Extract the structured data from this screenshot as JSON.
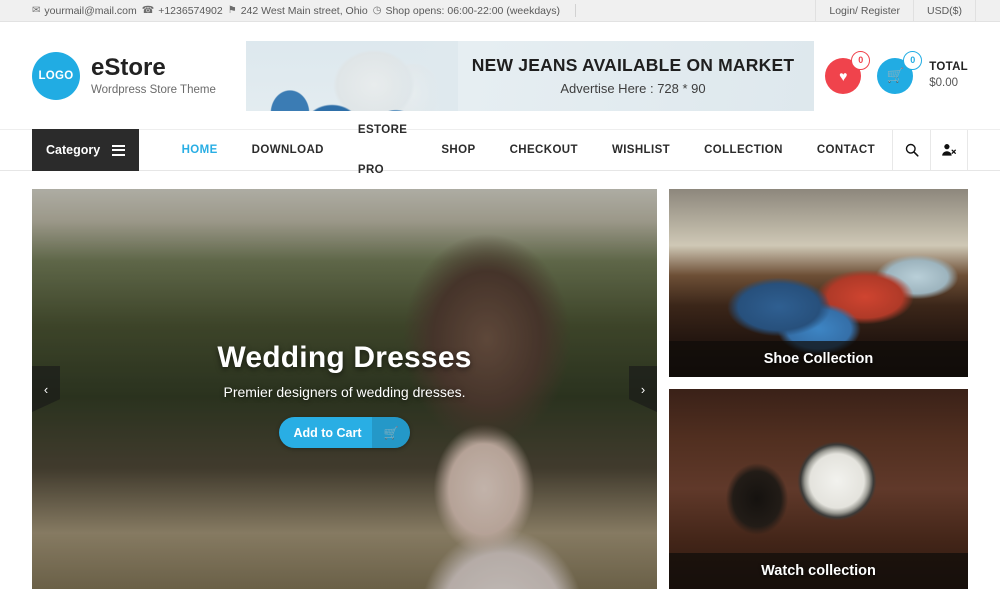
{
  "topbar": {
    "email": "yourmail@mail.com",
    "phone": "+1236574902",
    "address": "242 West Main street, Ohio",
    "hours": "Shop opens: 06:00-22:00 (weekdays)",
    "login": "Login/ Register",
    "currency": "USD($)",
    "icons": {
      "mail": "✉",
      "phone": "☎",
      "pin": "⚑",
      "clock": "◷"
    }
  },
  "header": {
    "logo_text": "LOGO",
    "brand_name": "eStore",
    "brand_tagline": "Wordpress Store Theme",
    "banner": {
      "title": "NEW JEANS AVAILABLE ON MARKET",
      "subtitle": "Advertise Here : 728 * 90"
    },
    "wishlist_count": "0",
    "cart_count": "0",
    "total_label": "TOTAL",
    "total_amount": "$0.00",
    "wishlist_icon": "♥",
    "cart_icon": "🛒"
  },
  "nav": {
    "category_label": "Category",
    "items": [
      {
        "label": "HOME",
        "active": true
      },
      {
        "label": "DOWNLOAD",
        "active": false
      },
      {
        "label": "ESTORE PRO",
        "active": false
      },
      {
        "label": "SHOP",
        "active": false
      },
      {
        "label": "CHECKOUT",
        "active": false
      },
      {
        "label": "WISHLIST",
        "active": false
      },
      {
        "label": "COLLECTION",
        "active": false
      },
      {
        "label": "CONTACT",
        "active": false
      }
    ],
    "search_icon": "🔍",
    "account_icon": "👤"
  },
  "slider": {
    "title": "Wedding Dresses",
    "subtitle": "Premier designers of wedding dresses.",
    "cta_label": "Add to Cart",
    "cta_icon": "🛒",
    "prev_icon": "‹",
    "next_icon": "›"
  },
  "cards": [
    {
      "label": "Shoe Collection"
    },
    {
      "label": "Watch collection"
    }
  ],
  "colors": {
    "accent_blue": "#21ace3",
    "nav_active": "#29aee4",
    "wishlist_red": "#f0434c",
    "category_dark": "#2b2b2b",
    "topbar_bg": "#f0f0f0"
  }
}
